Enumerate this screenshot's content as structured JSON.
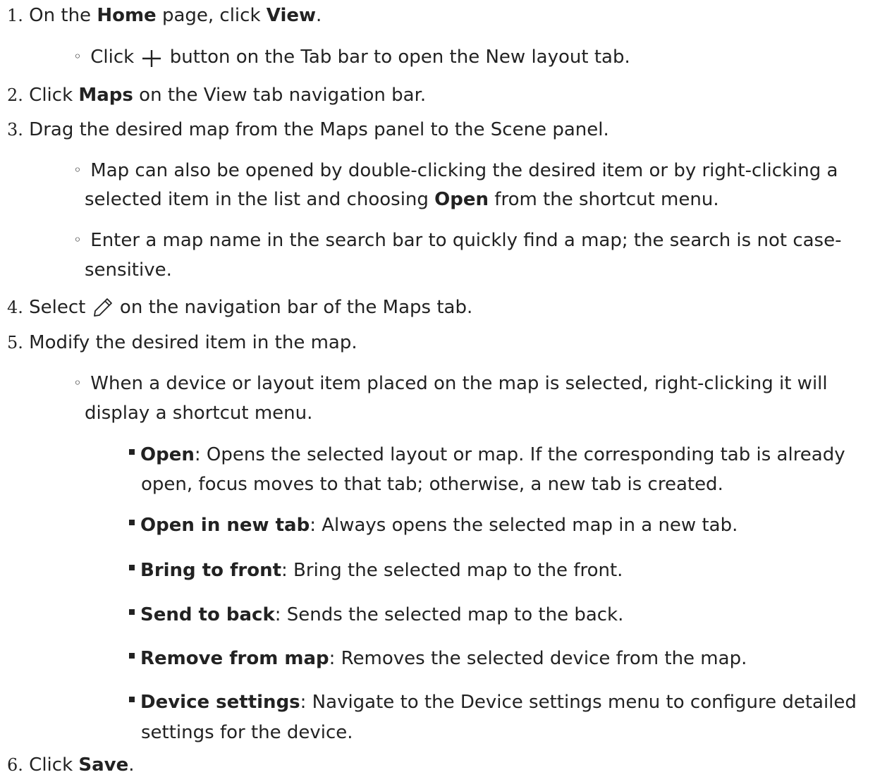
{
  "steps": [
    {
      "num": "1.",
      "pre": "On the ",
      "b1": "Home",
      "mid": " page, click ",
      "b2": "View",
      "post": "."
    },
    {
      "num": "2.",
      "pre": "Click ",
      "b1": "Maps",
      "post": " on the View tab navigation bar."
    },
    {
      "num": "3.",
      "text": "Drag the desired map from the Maps panel to the Scene panel."
    },
    {
      "num": "4.",
      "pre": "Select ",
      "post": " on the navigation bar of the Maps tab."
    },
    {
      "num": "5.",
      "text": "Modify the desired item in the map."
    },
    {
      "num": "6.",
      "pre": "Click ",
      "b1": "Save",
      "post": "."
    }
  ],
  "sub1": {
    "pre": "Click ",
    "post": " button on the Tab bar to open the New layout tab."
  },
  "sub3a": {
    "l1": "Map can also be opened by double-clicking the desired item or by right-clicking a",
    "l2pre": "selected item in the list and choosing ",
    "l2b": "Open",
    "l2post": " from the shortcut menu."
  },
  "sub3b": {
    "l1": "Enter a map name in the search bar to quickly find a map; the search is not case-",
    "l2": "sensitive."
  },
  "sub5": {
    "l1": "When a device or layout item placed on the map is selected, right-clicking it will",
    "l2": "display a shortcut menu."
  },
  "menu": [
    {
      "term": "Open",
      "desc": ": Opens the selected layout or map. If the corresponding tab is already",
      "desc2": "open, focus moves to that tab; otherwise, a new tab is created."
    },
    {
      "term": "Open in new tab",
      "desc": ": Always opens the selected map in a new tab."
    },
    {
      "term": "Bring to front",
      "desc": ": Bring the selected map to the front."
    },
    {
      "term": "Send to back",
      "desc": ": Sends the selected map to the back."
    },
    {
      "term": "Remove from map",
      "desc": ": Removes the selected device from the map."
    },
    {
      "term": "Device settings",
      "desc": ": Navigate to the Device settings menu to configure detailed",
      "desc2": "settings for the device."
    }
  ],
  "icons": {
    "plus": "plus-icon",
    "edit": "pencil-icon"
  }
}
